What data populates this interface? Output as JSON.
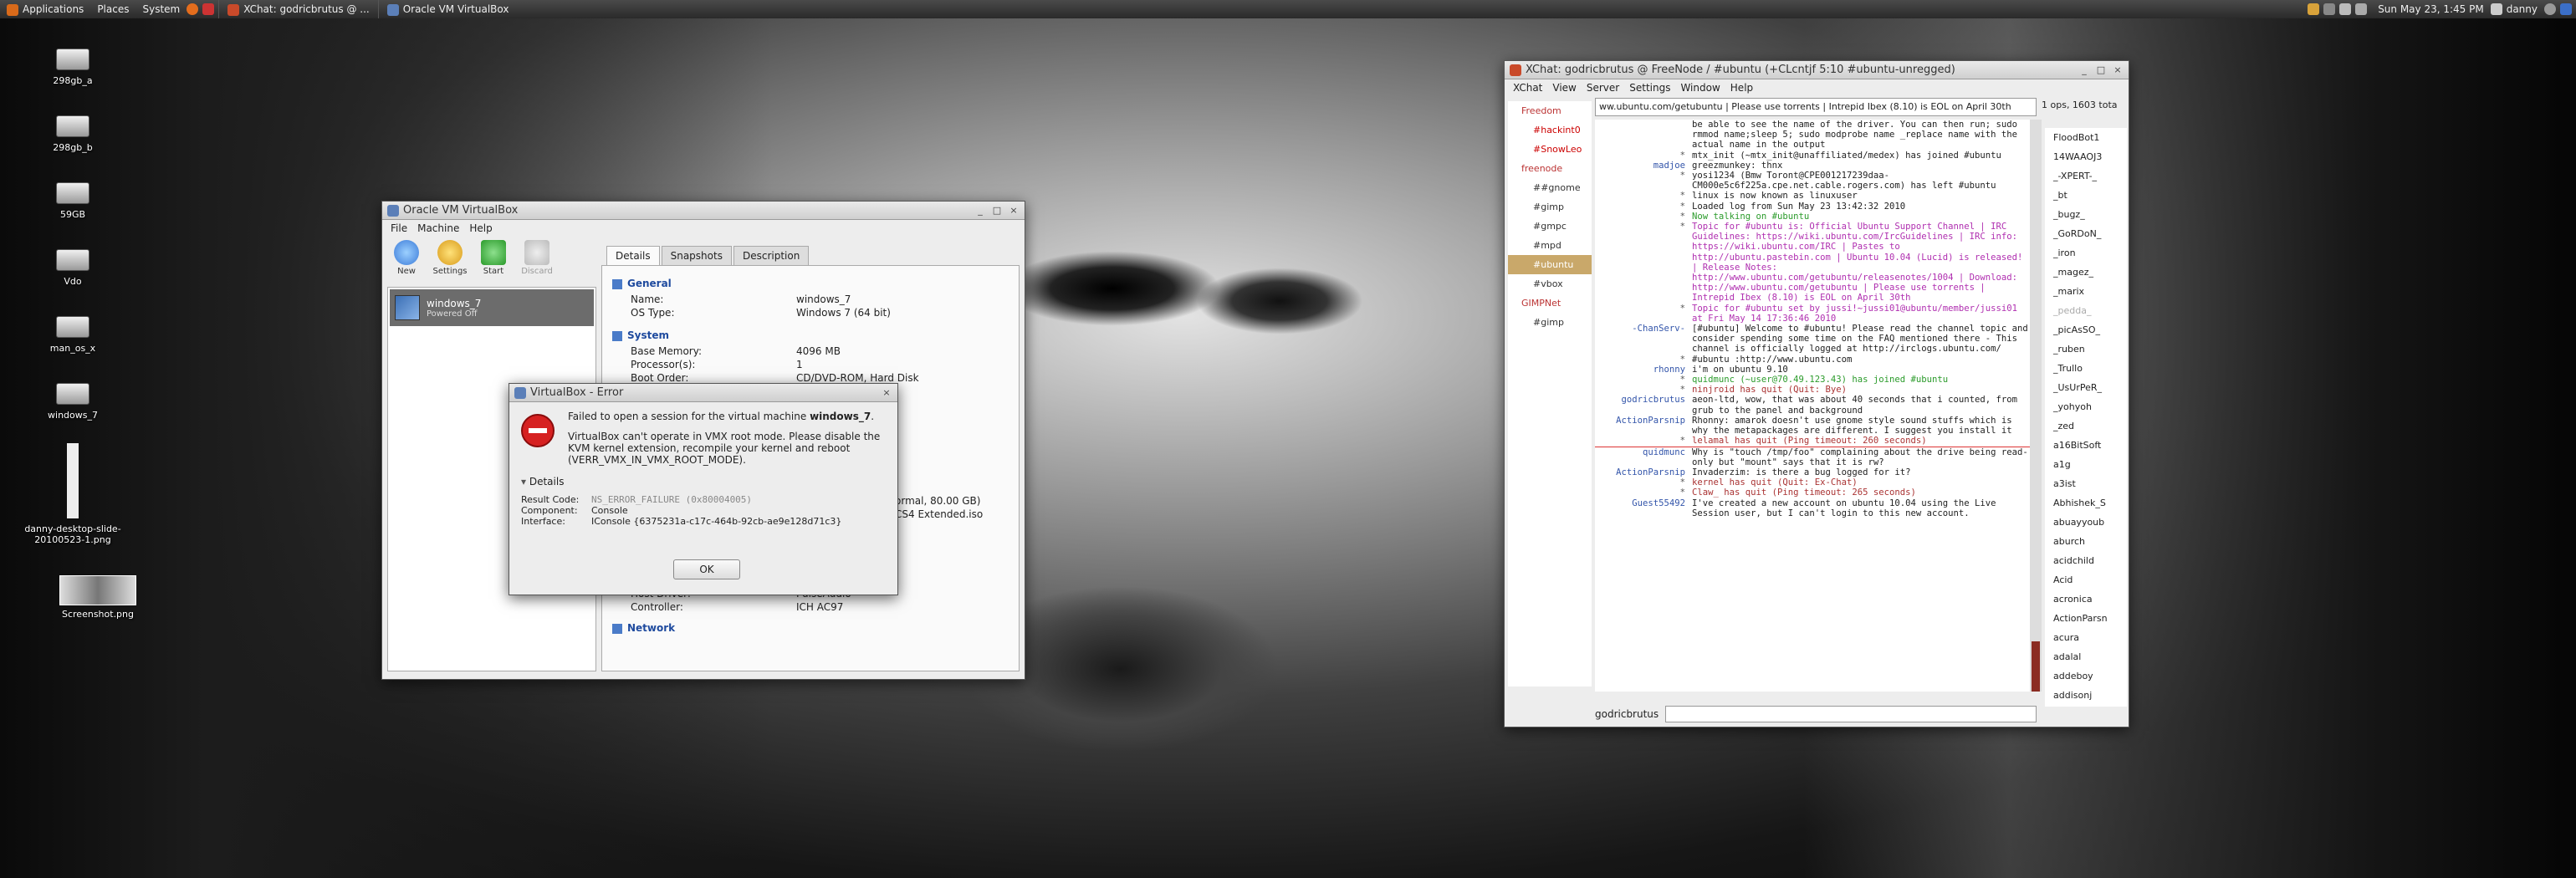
{
  "top_panel": {
    "menus": [
      "Applications",
      "Places",
      "System"
    ],
    "tasks": [
      "XChat: godricbrutus @ ...",
      "Oracle VM VirtualBox"
    ],
    "clock": "Sun May 23,  1:45 PM",
    "user": "danny"
  },
  "desktop_icons": [
    "298gb_a",
    "298gb_b",
    "59GB",
    "Vdo",
    "man_os_x",
    "windows_7",
    "danny-desktop-slide-20100523-1.png",
    "Screenshot.png"
  ],
  "vbox": {
    "title": "Oracle VM VirtualBox",
    "menu": [
      "File",
      "Machine",
      "Help"
    ],
    "toolbar": [
      "New",
      "Settings",
      "Start",
      "Discard"
    ],
    "vm_name": "windows_7",
    "vm_state": "Powered Off",
    "tabs": [
      "Details",
      "Snapshots",
      "Description"
    ],
    "general": "General",
    "name_k": "Name:",
    "name_v": "windows_7",
    "os_k": "OS Type:",
    "os_v": "Windows 7 (64 bit)",
    "system": "System",
    "mem_k": "Base Memory:",
    "mem_v": "4096 MB",
    "proc_k": "Processor(s):",
    "proc_v": "1",
    "boot_k": "Boot Order:",
    "boot_v": "CD/DVD-ROM, Hard Disk",
    "disk_tail": "ormal, 80.00 GB)",
    "iso_tail": "CS4 Extended.iso",
    "hostdrv_k": "Host Driver:",
    "hostdrv_v": "PulseAudio",
    "ctrl_k": "Controller:",
    "ctrl_v": "ICH AC97",
    "network": "Network"
  },
  "error": {
    "title": "VirtualBox - Error",
    "msg1_pre": "Failed to open a session for the virtual machine ",
    "msg1_vm": "windows_7",
    "msg1_post": ".",
    "msg2": "VirtualBox can't operate in VMX root mode. Please disable the KVM kernel extension, recompile your kernel and reboot (VERR_VMX_IN_VMX_ROOT_MODE).",
    "details": "Details",
    "rc_k": "Result Code:",
    "rc_v": "NS_ERROR_FAILURE (0x80004005)",
    "comp_k": "Component:",
    "comp_v": "Console",
    "iface_k": "Interface:",
    "iface_v": "IConsole {6375231a-c17c-464b-92cb-ae9e128d71c3}",
    "ok": "OK"
  },
  "xchat": {
    "title": "XChat: godricbrutus @ FreeNode / #ubuntu (+CLcntjf 5:10 #ubuntu-unregged)",
    "menu": [
      "XChat",
      "View",
      "Server",
      "Settings",
      "Window",
      "Help"
    ],
    "topic": "ww.ubuntu.com/getubuntu | Please use torrents | Intrepid Ibex (8.10) is EOL on April 30th",
    "ops": "1 ops, 1603 tota",
    "tree": [
      {
        "t": "Freedom",
        "c": "#b33"
      },
      {
        "t": "#hackint0",
        "c": "#c00"
      },
      {
        "t": "#SnowLeo",
        "c": "#c00"
      },
      {
        "t": "freenode",
        "c": "#b33"
      },
      {
        "t": "##gnome",
        "c": "#333"
      },
      {
        "t": "#gimp",
        "c": "#333"
      },
      {
        "t": "#gmpc",
        "c": "#333"
      },
      {
        "t": "#mpd",
        "c": "#333"
      },
      {
        "t": "#ubuntu",
        "c": "#fff"
      },
      {
        "t": "#vbox",
        "c": "#333"
      },
      {
        "t": "GIMPNet",
        "c": "#b33"
      },
      {
        "t": "#gimp",
        "c": "#333"
      }
    ],
    "lines": [
      {
        "n": "",
        "m": "be able to see the name of the driver. You can then run; sudo rmmod name;sleep 5; sudo modprobe name _replace name with the actual name in the output",
        "c": "#222"
      },
      {
        "n": "*",
        "m": "mtx_init (~mtx_init@unaffiliated/medex) has joined #ubuntu",
        "c": "#222"
      },
      {
        "n": "madjoe",
        "m": "greezmunkey: thnx",
        "c": "#222"
      },
      {
        "n": "*",
        "m": "yosi1234 (Bmw Toront@CPE001217239daa-CM000e5c6f225a.cpe.net.cable.rogers.com) has left #ubuntu",
        "c": "#222"
      },
      {
        "n": "*",
        "m": "linux is now known as linuxuser",
        "c": "#222"
      },
      {
        "n": "",
        "m": "",
        "c": "#222"
      },
      {
        "n": "*",
        "m": "Loaded log from Sun May 23 13:42:32 2010",
        "c": "#222"
      },
      {
        "n": "",
        "m": "",
        "c": "#222"
      },
      {
        "n": "*",
        "m": "Now talking on #ubuntu",
        "c": "#2b9b2b"
      },
      {
        "n": "*",
        "m": "Topic for #ubuntu is: Official Ubuntu Support Channel | IRC Guidelines: https://wiki.ubuntu.com/IrcGuidelines | IRC info: https://wiki.ubuntu.com/IRC | Pastes to http://ubuntu.pastebin.com | Ubuntu 10.04 (Lucid) is released! | Release Notes: http://www.ubuntu.com/getubuntu/releasenotes/1004 | Download: http://www.ubuntu.com/getubuntu | Please use torrents | Intrepid Ibex (8.10) is EOL on April 30th",
        "c": "#b02fb0"
      },
      {
        "n": "*",
        "m": "Topic for #ubuntu set by jussi!~jussi01@ubuntu/member/jussi01 at Fri May 14 17:36:46 2010",
        "c": "#b02fb0"
      },
      {
        "n": "-ChanServ-",
        "m": "[#ubuntu] Welcome to #ubuntu! Please read the channel topic and consider spending some time on the FAQ mentioned there - This channel is officially logged at http://irclogs.ubuntu.com/",
        "c": "#222"
      },
      {
        "n": "*",
        "m": "#ubuntu :http://www.ubuntu.com",
        "c": "#222"
      },
      {
        "n": "rhonny",
        "m": "i'm on ubuntu 9.10",
        "c": "#222"
      },
      {
        "n": "*",
        "m": "quidmunc (~user@70.49.123.43) has joined #ubuntu",
        "c": "#2b9b2b"
      },
      {
        "n": "*",
        "m": "ninjroid has quit (Quit: Bye)",
        "c": "#a33"
      },
      {
        "n": "godricbrutus",
        "m": "aeon-ltd, wow, that was about 40 seconds that i counted, from grub to the panel and background",
        "c": "#222"
      },
      {
        "n": "ActionParsnip",
        "m": "Rhonny: amarok doesn't use gnome style sound stuffs which is why the metapackages are different. I suggest you install it",
        "c": "#222"
      },
      {
        "n": "*",
        "m": "lelamal has quit (Ping timeout: 260 seconds)",
        "c": "#a33"
      },
      {
        "n": "quidmunc",
        "m": "Why is \"touch /tmp/foo\" complaining about the drive being read-only but \"mount\" says that it is rw?",
        "c": "#222"
      },
      {
        "n": "ActionParsnip",
        "m": "Invaderzim: is there a bug logged for it?",
        "c": "#222"
      },
      {
        "n": "*",
        "m": "kernel has quit (Quit: Ex-Chat)",
        "c": "#a33"
      },
      {
        "n": "*",
        "m": "Claw_ has quit (Ping timeout: 265 seconds)",
        "c": "#a33"
      },
      {
        "n": "Guest55492",
        "m": "I've created a new account on ubuntu 10.04 using the Live Session user, but I can't login to this new account.",
        "c": "#222"
      }
    ],
    "users": [
      "FloodBot1",
      "14WAAOJ3",
      "_-XPERT-_",
      "_bt",
      "_bugz_",
      "_GoRDoN_",
      "_iron",
      "_magez_",
      "_marix",
      "_pedda_",
      "_picAsSO_",
      "_ruben",
      "_Trullo",
      "_UsUrPeR_",
      "_yohyoh",
      "_zed",
      "a16BitSoft",
      "a1g",
      "a3ist",
      "Abhishek_S",
      "abuayyoub",
      "aburch",
      "acidchild",
      "Acid",
      "acronica",
      "ActionParsn",
      "acura",
      "adalal",
      "addeboy",
      "addisonj"
    ],
    "input_nick": "godricbrutus"
  }
}
